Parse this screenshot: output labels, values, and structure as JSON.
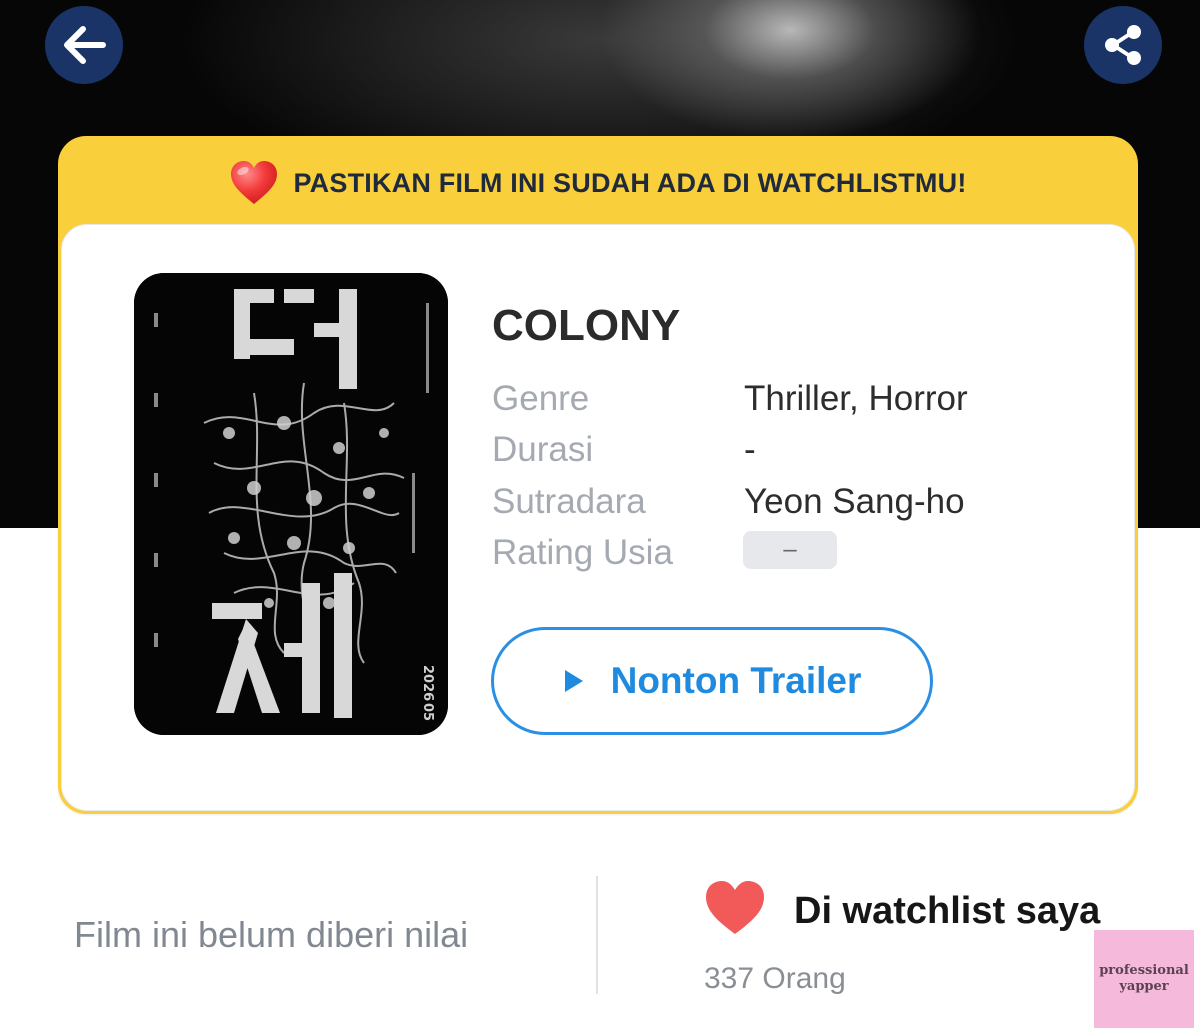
{
  "header": {
    "back_icon": "arrow-left-icon",
    "share_icon": "share-icon"
  },
  "banner": {
    "icon": "heart-icon",
    "text": "PASTIKAN FILM INI SUDAH ADA DI WATCHLISTMU!"
  },
  "movie": {
    "title": "COLONY",
    "details": [
      {
        "label": "Genre",
        "value": "Thriller, Horror"
      },
      {
        "label": "Durasi",
        "value": "-"
      },
      {
        "label": "Sutradara",
        "value": "Yeon Sang-ho"
      },
      {
        "label": "Rating Usia",
        "value": "–"
      }
    ],
    "trailer_button": {
      "icon": "play-icon",
      "label": "Nonton Trailer"
    },
    "poster": {
      "year_text": "2026",
      "month_text": "05"
    }
  },
  "footer": {
    "rating_text": "Film ini belum diberi nilai",
    "watchlist": {
      "icon": "heart-icon",
      "title": "Di watchlist saya",
      "count": "337 Orang"
    }
  },
  "watermark": {
    "line1": "professional",
    "line2": "yapper"
  },
  "colors": {
    "banner_yellow": "#f9cf3b",
    "button_navy": "#1a3467",
    "accent_blue": "#1e8be0",
    "heart_red": "#f25a5a"
  }
}
